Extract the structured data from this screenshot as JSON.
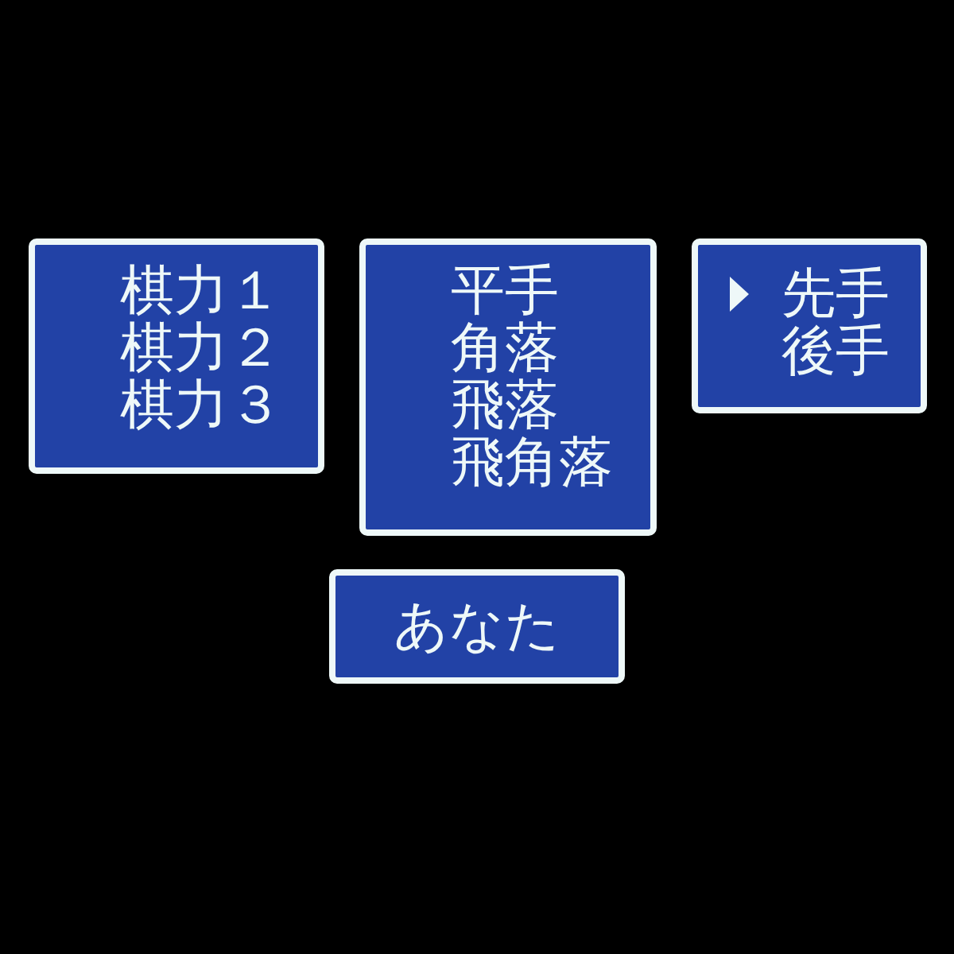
{
  "strength_menu": {
    "items": [
      "棋力１",
      "棋力２",
      "棋力３"
    ]
  },
  "handicap_menu": {
    "items": [
      "平手",
      "角落",
      "飛落",
      "飛角落"
    ]
  },
  "turn_menu": {
    "items": [
      {
        "label": "先手",
        "selected": true
      },
      {
        "label": "後手",
        "selected": false
      }
    ]
  },
  "player_panel": {
    "label": "あなた"
  }
}
